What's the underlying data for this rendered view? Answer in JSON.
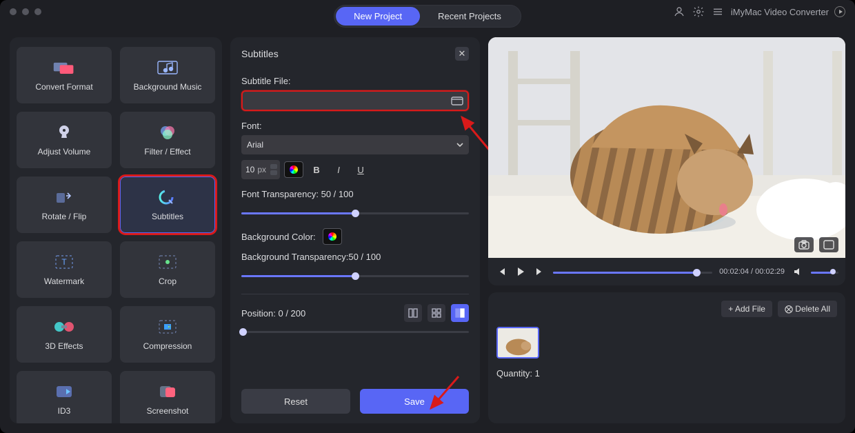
{
  "header": {
    "tabs": [
      {
        "label": "New Project",
        "active": true
      },
      {
        "label": "Recent Projects",
        "active": false
      }
    ],
    "app_name": "iMyMac Video Converter"
  },
  "sidebar": {
    "tiles": [
      {
        "id": "convert-format",
        "label": "Convert Format"
      },
      {
        "id": "background-music",
        "label": "Background Music"
      },
      {
        "id": "adjust-volume",
        "label": "Adjust Volume"
      },
      {
        "id": "filter-effect",
        "label": "Filter / Effect"
      },
      {
        "id": "rotate-flip",
        "label": "Rotate / Flip"
      },
      {
        "id": "subtitles",
        "label": "Subtitles",
        "selected": true
      },
      {
        "id": "watermark",
        "label": "Watermark"
      },
      {
        "id": "crop",
        "label": "Crop"
      },
      {
        "id": "3d-effects",
        "label": "3D Effects"
      },
      {
        "id": "compression",
        "label": "Compression"
      },
      {
        "id": "id3",
        "label": "ID3"
      },
      {
        "id": "screenshot",
        "label": "Screenshot"
      }
    ]
  },
  "panel": {
    "title": "Subtitles",
    "file_label": "Subtitle File:",
    "file_value": "",
    "font_label": "Font:",
    "font_value": "Arial",
    "font_size_value": "10",
    "font_size_unit": "px",
    "font_transparency_label": "Font Transparency: 50 / 100",
    "font_transparency_pct": 50,
    "bgcolor_label": "Background Color:",
    "bg_transparency_label": "Background Transparency:50 / 100",
    "bg_transparency_pct": 50,
    "position_label": "Position: 0 / 200",
    "position_pct": 0,
    "reset_label": "Reset",
    "save_label": "Save"
  },
  "player": {
    "time_current": "00:02:04",
    "time_total": "00:02:29",
    "progress_pct": 90
  },
  "files": {
    "add_label": "+ Add File",
    "delete_label": "⨂ Delete All",
    "quantity_label": "Quantity: 1"
  }
}
